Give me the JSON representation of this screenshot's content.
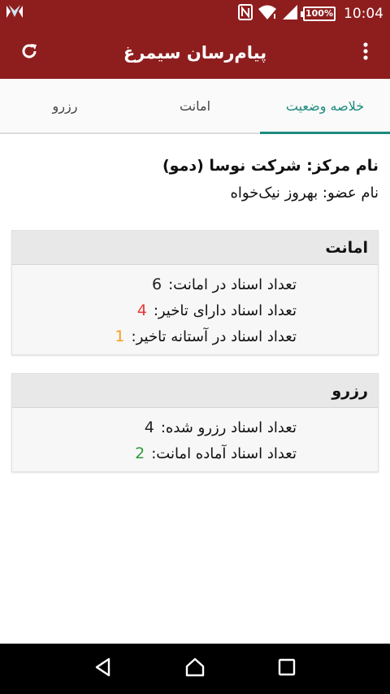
{
  "status_bar": {
    "time": "10:04",
    "battery": "100%",
    "icons": [
      "notification-app-icon",
      "nfc-icon",
      "wifi-icon",
      "cell-signal-icon",
      "battery-icon"
    ]
  },
  "app_bar": {
    "title": "پیام‌رسان سیمرغ",
    "left_icon": "refresh-icon",
    "right_icon": "overflow-menu-icon"
  },
  "tabs": [
    {
      "label": "رزرو",
      "active": false
    },
    {
      "label": "امانت",
      "active": false
    },
    {
      "label": "خلاصه وضعیت",
      "active": true
    }
  ],
  "summary": {
    "center_name": "نام مرکز: شرکت نوسا (دمو)",
    "member_name": "نام عضو: بهروز نیک‌خواه"
  },
  "loan_card": {
    "title": "امانت",
    "rows": [
      {
        "label": "تعداد اسناد در امانت:",
        "value": "6",
        "color": "#222222"
      },
      {
        "label": "تعداد اسناد دارای تاخیر:",
        "value": "4",
        "color": "#e53935"
      },
      {
        "label": "تعداد اسناد در آستانه تاخیر:",
        "value": "1",
        "color": "#f59c1a"
      }
    ]
  },
  "reserve_card": {
    "title": "رزرو",
    "rows": [
      {
        "label": "تعداد اسناد رزرو شده:",
        "value": "4",
        "color": "#222222"
      },
      {
        "label": "تعداد اسناد آماده امانت:",
        "value": "2",
        "color": "#2e9b3a"
      }
    ]
  },
  "nav_bar": {
    "icons": [
      "back-icon",
      "home-icon",
      "recents-icon"
    ]
  },
  "colors": {
    "primary": "#8e1e1e",
    "accent": "#1d8a7e"
  }
}
